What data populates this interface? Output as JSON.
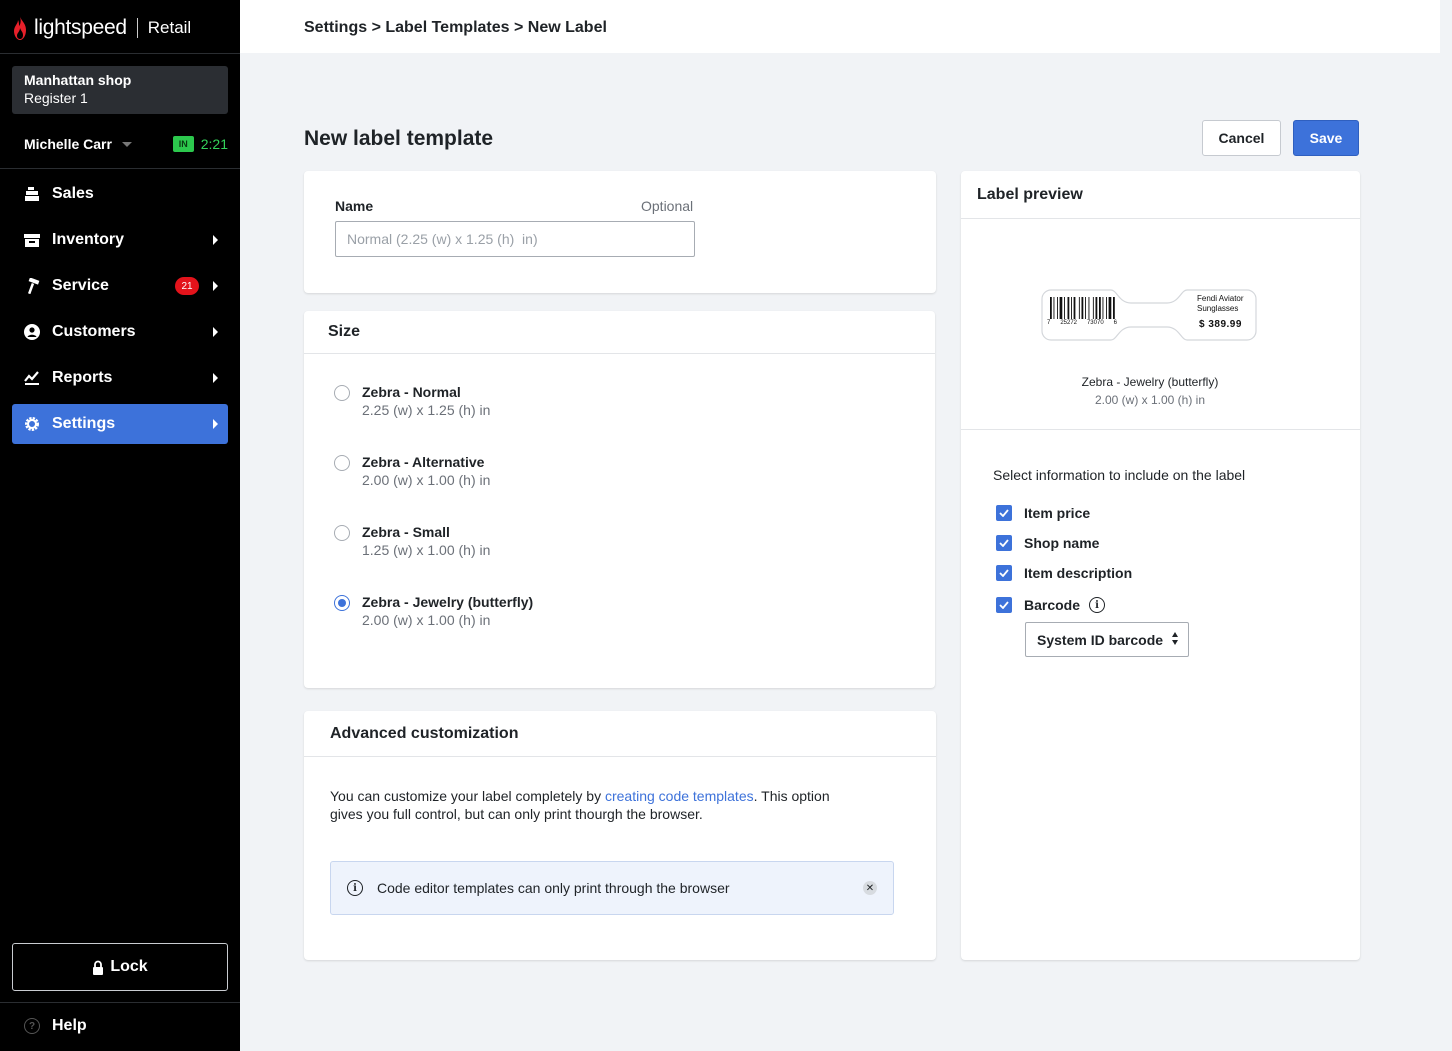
{
  "app": {
    "brand": "lightspeed",
    "product": "Retail"
  },
  "shop": {
    "name": "Manhattan shop",
    "register": "Register 1"
  },
  "user": {
    "name": "Michelle Carr",
    "status": "IN",
    "time": "2:21"
  },
  "nav": [
    {
      "label": "Sales",
      "icon": "register-icon",
      "active": false
    },
    {
      "label": "Inventory",
      "icon": "box-icon",
      "active": false
    },
    {
      "label": "Service",
      "icon": "hammer-icon",
      "badge": "21",
      "active": false
    },
    {
      "label": "Customers",
      "icon": "person-icon",
      "active": false
    },
    {
      "label": "Reports",
      "icon": "chart-icon",
      "active": false
    },
    {
      "label": "Settings",
      "icon": "gear-icon",
      "active": true
    }
  ],
  "sidebar_footer": {
    "lock_label": "Lock",
    "help_label": "Help"
  },
  "breadcrumb": "Settings > Label Templates > New Label",
  "page": {
    "title": "New label template",
    "cancel_label": "Cancel",
    "save_label": "Save"
  },
  "name_field": {
    "label": "Name",
    "optional": "Optional",
    "value": "",
    "placeholder": "Normal (2.25 (w) x 1.25 (h)  in)"
  },
  "size": {
    "title": "Size",
    "options": [
      {
        "title": "Zebra - Normal",
        "dims": "2.25 (w) x 1.25 (h)  in",
        "checked": false
      },
      {
        "title": "Zebra - Alternative",
        "dims": "2.00 (w) x 1.00 (h) in",
        "checked": false
      },
      {
        "title": "Zebra - Small",
        "dims": "1.25 (w) x 1.00 (h) in",
        "checked": false
      },
      {
        "title": "Zebra - Jewelry (butterfly)",
        "dims": "2.00 (w) x 1.00 (h) in",
        "checked": true
      }
    ]
  },
  "advanced": {
    "title": "Advanced  customization",
    "text_before": "You can customize your label completely by ",
    "link": "creating code templates",
    "text_after": ". This option gives you full control, but can only print thourgh the browser.",
    "info": "Code editor templates  can only print through the browser"
  },
  "preview": {
    "title": "Label preview",
    "label_item": "Fendi Aviator Sunglasses",
    "label_price": "$ 389.99",
    "barcode_digits": [
      "7",
      "25272",
      "73070",
      "6"
    ],
    "template_name": "Zebra - Jewelry (butterfly)",
    "template_dims": "2.00 (w) x 1.00 (h) in",
    "select_info": "Select information to include on the label",
    "options": [
      {
        "label": "Item price",
        "checked": true
      },
      {
        "label": "Shop name",
        "checked": true
      },
      {
        "label": "Item description",
        "checked": true
      },
      {
        "label": "Barcode",
        "checked": true
      }
    ],
    "barcode_type": "System ID barcode"
  },
  "colors": {
    "accent": "#3d72da",
    "sidebar": "#000000",
    "badge": "#e3131b",
    "clock": "#33d35a"
  }
}
